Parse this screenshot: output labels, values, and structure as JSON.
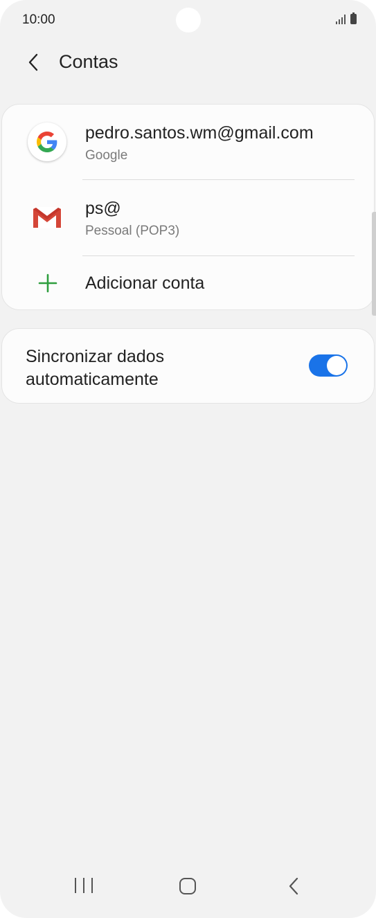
{
  "status_bar": {
    "time": "10:00"
  },
  "header": {
    "title": "Contas"
  },
  "accounts": [
    {
      "title": "pedro.santos.wm@gmail.com",
      "subtitle": "Google",
      "icon": "google-g-icon"
    },
    {
      "title": "ps@",
      "subtitle": "Pessoal (POP3)",
      "icon": "gmail-m-icon"
    }
  ],
  "add_account": {
    "label": "Adicionar conta",
    "icon": "plus-icon"
  },
  "sync": {
    "label": "Sincronizar dados automaticamente",
    "enabled": true
  },
  "colors": {
    "accent": "#1a73e8",
    "plus": "#2e9e3e",
    "background": "#f2f2f2"
  },
  "nav": {
    "icons": [
      "recent-apps-icon",
      "home-icon",
      "back-icon"
    ]
  }
}
